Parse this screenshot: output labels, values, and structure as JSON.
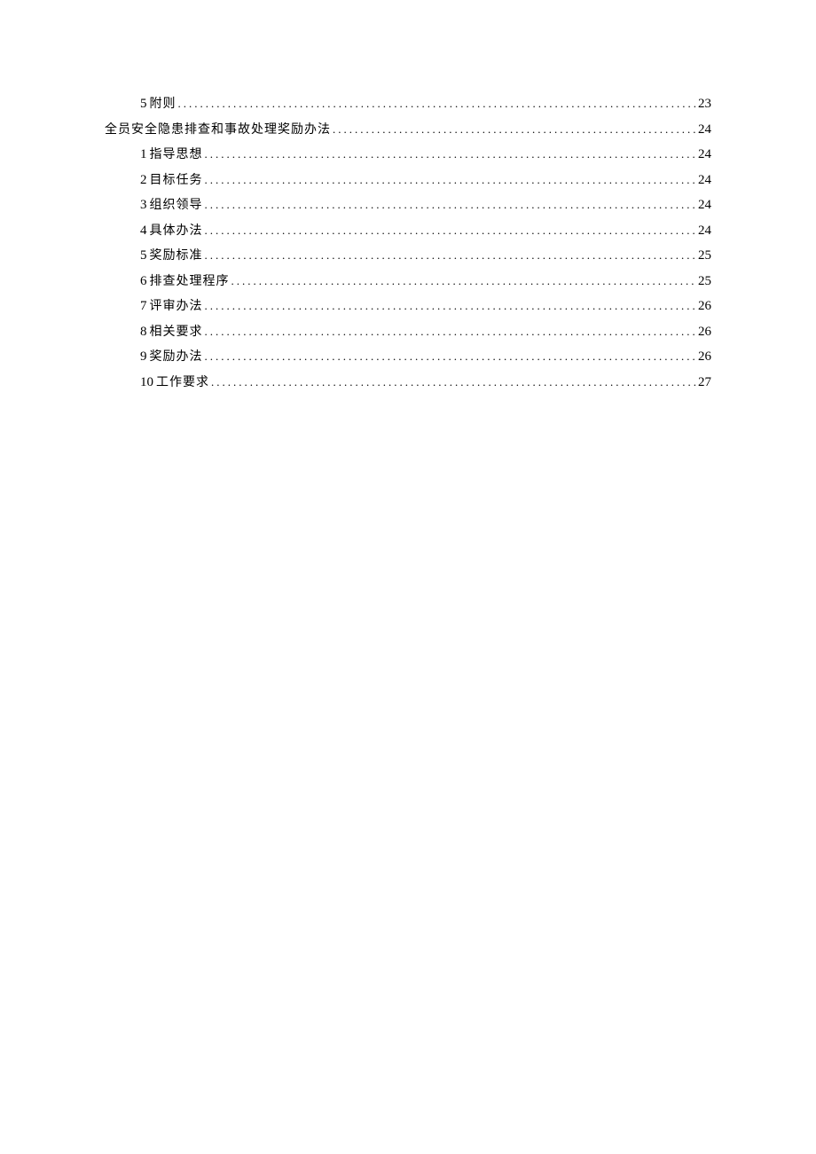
{
  "toc": [
    {
      "level": 2,
      "number": "5",
      "text": "附则",
      "page": "23"
    },
    {
      "level": 1,
      "number": "",
      "text": "全员安全隐患排查和事故处理奖励办法",
      "page": "24"
    },
    {
      "level": 2,
      "number": "1",
      "text": "指导思想",
      "page": "24"
    },
    {
      "level": 2,
      "number": "2",
      "text": "目标任务",
      "page": "24"
    },
    {
      "level": 2,
      "number": "3",
      "text": "组织领导",
      "page": "24"
    },
    {
      "level": 2,
      "number": "4",
      "text": "具体办法",
      "page": "24"
    },
    {
      "level": 2,
      "number": "5",
      "text": "奖励标准",
      "page": "25"
    },
    {
      "level": 2,
      "number": "6",
      "text": "排查处理程序",
      "page": "25"
    },
    {
      "level": 2,
      "number": "7",
      "text": "评审办法",
      "page": "26"
    },
    {
      "level": 2,
      "number": "8",
      "text": "相关要求",
      "page": "26"
    },
    {
      "level": 2,
      "number": "9",
      "text": "奖励办法",
      "page": "26"
    },
    {
      "level": 2,
      "number": "10",
      "text": "工作要求",
      "page": "27"
    }
  ]
}
